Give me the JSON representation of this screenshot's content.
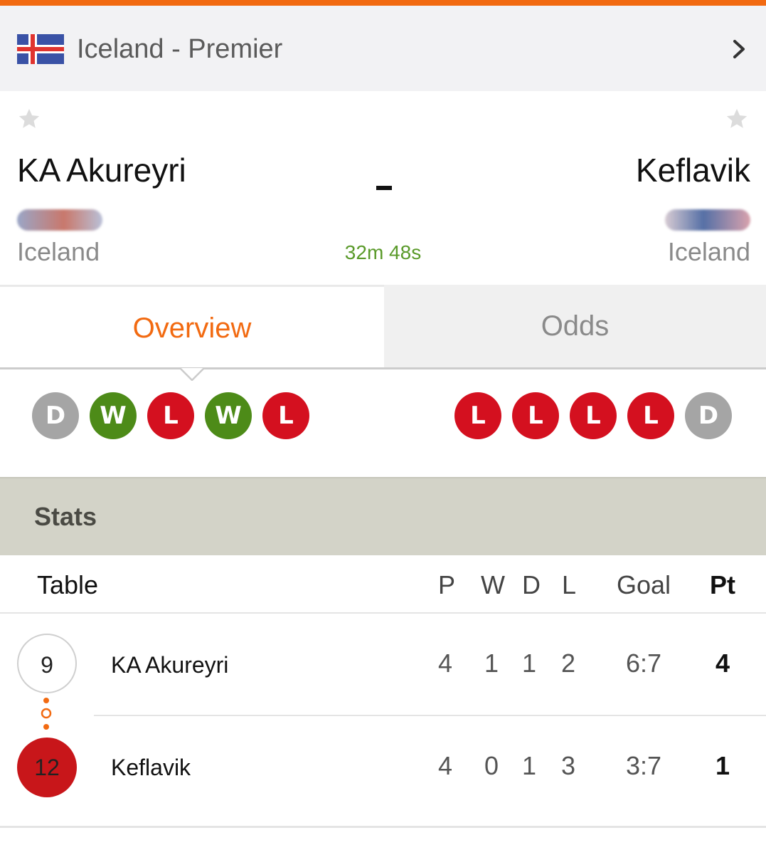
{
  "colors": {
    "accent": "#f26a11",
    "win": "#4d8b18",
    "loss": "#d4101f",
    "draw": "#a5a5a5",
    "countdown": "#5a9a2a",
    "stats_header_bg": "#d3d3c8"
  },
  "league": {
    "flag_icon": "iceland-flag-icon",
    "name": "Iceland - Premier"
  },
  "match": {
    "home": {
      "name": "KA Akureyri",
      "country": "Iceland"
    },
    "away": {
      "name": "Keflavik",
      "country": "Iceland"
    },
    "score": "-",
    "countdown": "32m 48s"
  },
  "tabs": [
    {
      "label": "Overview",
      "active": true
    },
    {
      "label": "Odds",
      "active": false
    }
  ],
  "form": {
    "home": [
      "D",
      "W",
      "L",
      "W",
      "L"
    ],
    "away": [
      "L",
      "L",
      "L",
      "L",
      "D"
    ]
  },
  "stats": {
    "title": "Stats",
    "table": {
      "label": "Table",
      "headers": {
        "p": "P",
        "w": "W",
        "d": "D",
        "l": "L",
        "goal": "Goal",
        "pt": "Pt"
      },
      "rows": [
        {
          "rank": "9",
          "team": "KA Akureyri",
          "p": "4",
          "w": "1",
          "d": "1",
          "l": "2",
          "goal": "6:7",
          "pt": "4"
        },
        {
          "rank": "12",
          "team": "Keflavik",
          "p": "4",
          "w": "0",
          "d": "1",
          "l": "3",
          "goal": "3:7",
          "pt": "1"
        }
      ]
    }
  }
}
